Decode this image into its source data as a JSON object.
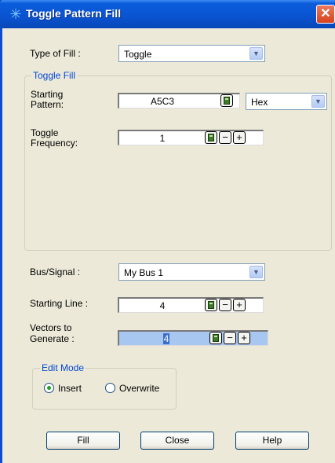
{
  "window": {
    "title": "Toggle Pattern Fill",
    "close_glyph": "✕",
    "title_icon": "asterisk-icon"
  },
  "type_of_fill": {
    "label": "Type of Fill :",
    "value": "Toggle"
  },
  "toggle_fill": {
    "title": "Toggle Fill",
    "starting_pattern": {
      "label_line1": "Starting",
      "label_line2": "Pattern:",
      "value": "A5C3",
      "format": "Hex"
    },
    "toggle_frequency": {
      "label_line1": "Toggle",
      "label_line2": "Frequency:",
      "value": "1"
    }
  },
  "bus_signal": {
    "label": "Bus/Signal :",
    "value": "My Bus 1"
  },
  "starting_line": {
    "label": "Starting Line :",
    "value": "4"
  },
  "vectors": {
    "label_line1": "Vectors to",
    "label_line2": "Generate :",
    "value": "4"
  },
  "edit_mode": {
    "title": "Edit Mode",
    "options": [
      {
        "label": "Insert",
        "selected": true
      },
      {
        "label": "Overwrite",
        "selected": false
      }
    ]
  },
  "stepper": {
    "minus": "−",
    "plus": "+"
  },
  "buttons": {
    "fill": "Fill",
    "close": "Close",
    "help": "Help"
  },
  "colors": {
    "title_bar": "#0a53d0",
    "group_title": "#0046d5",
    "dialog_bg": "#ece9d8"
  }
}
